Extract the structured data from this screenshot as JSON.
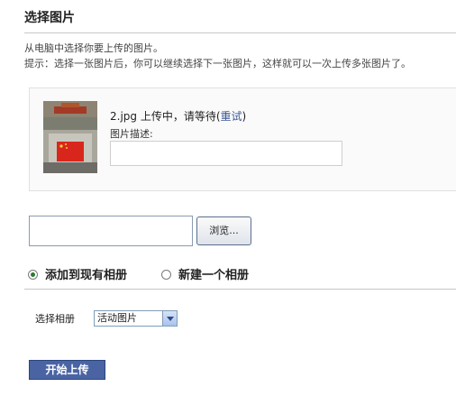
{
  "page": {
    "title": "选择图片"
  },
  "intro": {
    "line1": "从电脑中选择你要上传的图片。",
    "line2": "提示：选择一张图片后，你可以继续选择下一张图片，这样就可以一次上传多张图片了。"
  },
  "upload_item": {
    "status_text": "2.jpg 上传中，请等待(",
    "retry_label": "重试",
    "status_close": ")",
    "description_label": "图片描述:",
    "description_value": ""
  },
  "file_picker": {
    "value": "",
    "browse_label": "浏览..."
  },
  "album_choice": {
    "option_existing": "添加到现有相册",
    "option_new": "新建一个相册",
    "selected": "existing"
  },
  "album_select": {
    "label": "选择相册",
    "selected_value": "活动图片"
  },
  "actions": {
    "start_upload_label": "开始上传"
  },
  "colors": {
    "accent": "#3b5998",
    "button_bg": "#4a64a3"
  }
}
